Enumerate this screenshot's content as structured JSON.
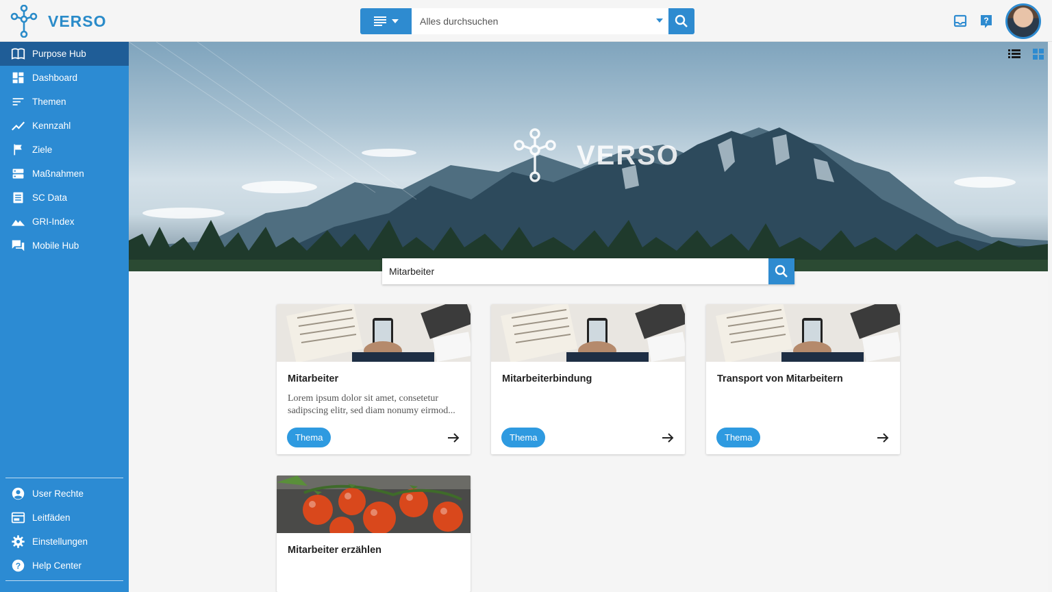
{
  "app": {
    "brand": "VERSO"
  },
  "search": {
    "placeholder": "Alles durchsuchen"
  },
  "sidebar": {
    "items": [
      {
        "label": "Purpose Hub",
        "icon": "book-open-icon",
        "active": true
      },
      {
        "label": "Dashboard",
        "icon": "dashboard-icon"
      },
      {
        "label": "Themen",
        "icon": "sort-lines-icon"
      },
      {
        "label": "Kennzahl",
        "icon": "trend-line-icon"
      },
      {
        "label": "Ziele",
        "icon": "flag-icon"
      },
      {
        "label": "Maßnahmen",
        "icon": "storage-icon"
      },
      {
        "label": "SC Data",
        "icon": "list-document-icon"
      },
      {
        "label": "GRI-Index",
        "icon": "mountain-icon"
      },
      {
        "label": "Mobile Hub",
        "icon": "chat-icon"
      }
    ],
    "bottom_items": [
      {
        "label": "User Rechte",
        "icon": "account-circle-icon"
      },
      {
        "label": "Leitfäden",
        "icon": "web-panel-icon"
      },
      {
        "label": "Einstellungen",
        "icon": "gear-icon"
      },
      {
        "label": "Help Center",
        "icon": "help-circle-icon"
      }
    ]
  },
  "hero": {
    "brand": "VERSO",
    "search_value": "Mitarbeiter"
  },
  "cards": [
    {
      "title": "Mitarbeiter",
      "description": "Lorem ipsum dolor sit amet, consetetur sadipscing elitr, sed diam nonumy eirmod...",
      "tag": "Thema",
      "image": "business-desk-image"
    },
    {
      "title": "Mitarbeiterbindung",
      "description": "",
      "tag": "Thema",
      "image": "business-desk-image"
    },
    {
      "title": "Transport von Mitarbeitern",
      "description": "",
      "tag": "Thema",
      "image": "business-desk-image"
    },
    {
      "title": "Mitarbeiter erzählen",
      "description": "",
      "tag": "",
      "image": "tomatoes-image"
    }
  ],
  "colors": {
    "primary": "#2c8bd3",
    "sidebar_active": "#1f5d97",
    "tag": "#2e9ae0"
  }
}
